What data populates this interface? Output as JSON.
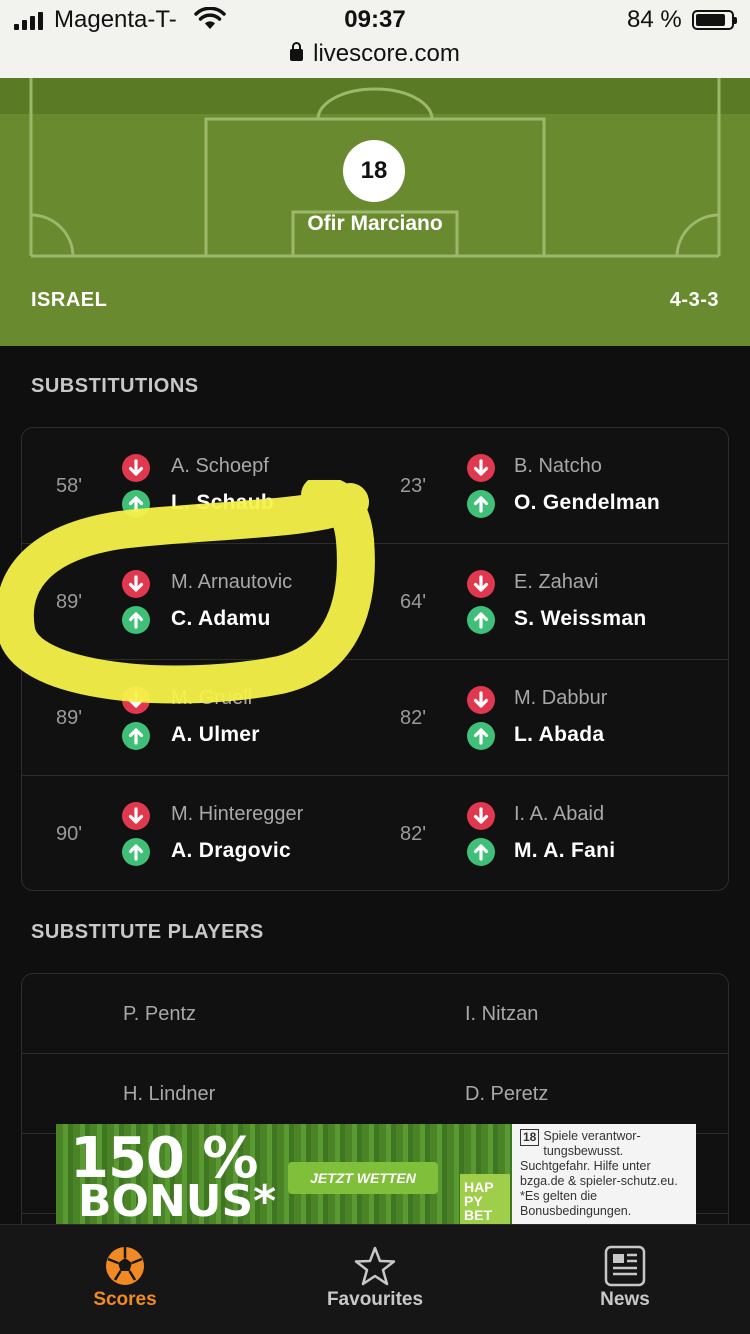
{
  "status_bar": {
    "carrier": "Magenta-T-",
    "time": "09:37",
    "battery": "84 %",
    "url": "livescore.com"
  },
  "lineup": {
    "goalkeeper_number": "18",
    "goalkeeper_name": "Ofir Marciano",
    "team": "ISRAEL",
    "formation": "4-3-3",
    "pitch_color": "#6a8a30"
  },
  "substitutions": {
    "title": "SUBSTITUTIONS",
    "rows": [
      {
        "left": {
          "minute": "58'",
          "out": "A. Schoepf",
          "in": "L. Schaub"
        },
        "right": {
          "minute": "23'",
          "out": "B. Natcho",
          "in": "O. Gendelman"
        }
      },
      {
        "left": {
          "minute": "89'",
          "out": "M. Arnautovic",
          "in": "C. Adamu"
        },
        "right": {
          "minute": "64'",
          "out": "E. Zahavi",
          "in": "S. Weissman"
        }
      },
      {
        "left": {
          "minute": "89'",
          "out": "M. Gruell",
          "in": "A. Ulmer"
        },
        "right": {
          "minute": "82'",
          "out": "M. Dabbur",
          "in": "L. Abada"
        }
      },
      {
        "left": {
          "minute": "90'",
          "out": "M. Hinteregger",
          "in": "A. Dragovic"
        },
        "right": {
          "minute": "82'",
          "out": "I. A. Abaid",
          "in": "M. A. Fani"
        }
      }
    ],
    "out_color": "#e0384f",
    "in_color": "#3fbf78"
  },
  "substitute_players": {
    "title": "SUBSTITUTE PLAYERS",
    "rows": [
      {
        "left": "P. Pentz",
        "right": "I. Nitzan"
      },
      {
        "left": "H. Lindner",
        "right": "D. Peretz"
      }
    ]
  },
  "ad": {
    "bonus_percent": "150 %",
    "bonus_word": "BONUS*",
    "cta": "JETZT WETTEN",
    "logo": "HAP PY BET",
    "age": "18",
    "disclaimer": "Spiele verantwor-tungsbewusst. Suchtgefahr. Hilfe unter bzga.de & spieler-schutz.eu. *Es gelten die Bonusbedingungen."
  },
  "tabbar": {
    "tabs": [
      {
        "label": "Scores",
        "icon": "football-icon",
        "active": true
      },
      {
        "label": "Favourites",
        "icon": "star-icon",
        "active": false
      },
      {
        "label": "News",
        "icon": "news-icon",
        "active": false
      }
    ],
    "accent_color": "#f08a24"
  }
}
